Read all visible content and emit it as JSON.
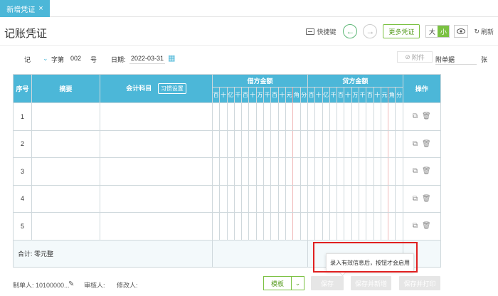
{
  "tab": {
    "label": "新增凭证",
    "close": "×"
  },
  "title": "记账凭证",
  "toolbar": {
    "shortcut_label": "快捷键",
    "more_voucher": "更多凭证",
    "size_large": "大",
    "size_small": "小",
    "refresh": "刷新"
  },
  "meta": {
    "voucher_type": "记",
    "word_label": "字第",
    "number": "002",
    "number_unit": "号",
    "date_label": "日期:",
    "date": "2022-03-31",
    "attach_btn": "附件",
    "attach_label": "附单据",
    "attach_unit": "张"
  },
  "table": {
    "headers": {
      "seq": "序号",
      "summary": "摘要",
      "subject": "会计科目",
      "habit": "习惯设置",
      "debit": "借方金额",
      "credit": "贷方金额",
      "ops": "操作"
    },
    "digits": [
      "百",
      "十",
      "亿",
      "千",
      "百",
      "十",
      "万",
      "千",
      "百",
      "十",
      "元",
      "角",
      "分"
    ],
    "rows": [
      {
        "num": "1"
      },
      {
        "num": "2"
      },
      {
        "num": "3"
      },
      {
        "num": "4"
      },
      {
        "num": "5"
      }
    ],
    "total_label": "合计: 零元整"
  },
  "footer": {
    "maker": "制单人: 10100000...",
    "auditor": "审核人:",
    "modifier": "修改人:",
    "template": "模板",
    "save": "保存",
    "save_new": "保存并新增",
    "save_print": "保存并打印"
  },
  "tooltip": "录入有效信息后，按钮才会启用",
  "colors": {
    "header": "#4cb7d8",
    "accent_green": "#7bc142",
    "highlight_red": "#e02020"
  }
}
